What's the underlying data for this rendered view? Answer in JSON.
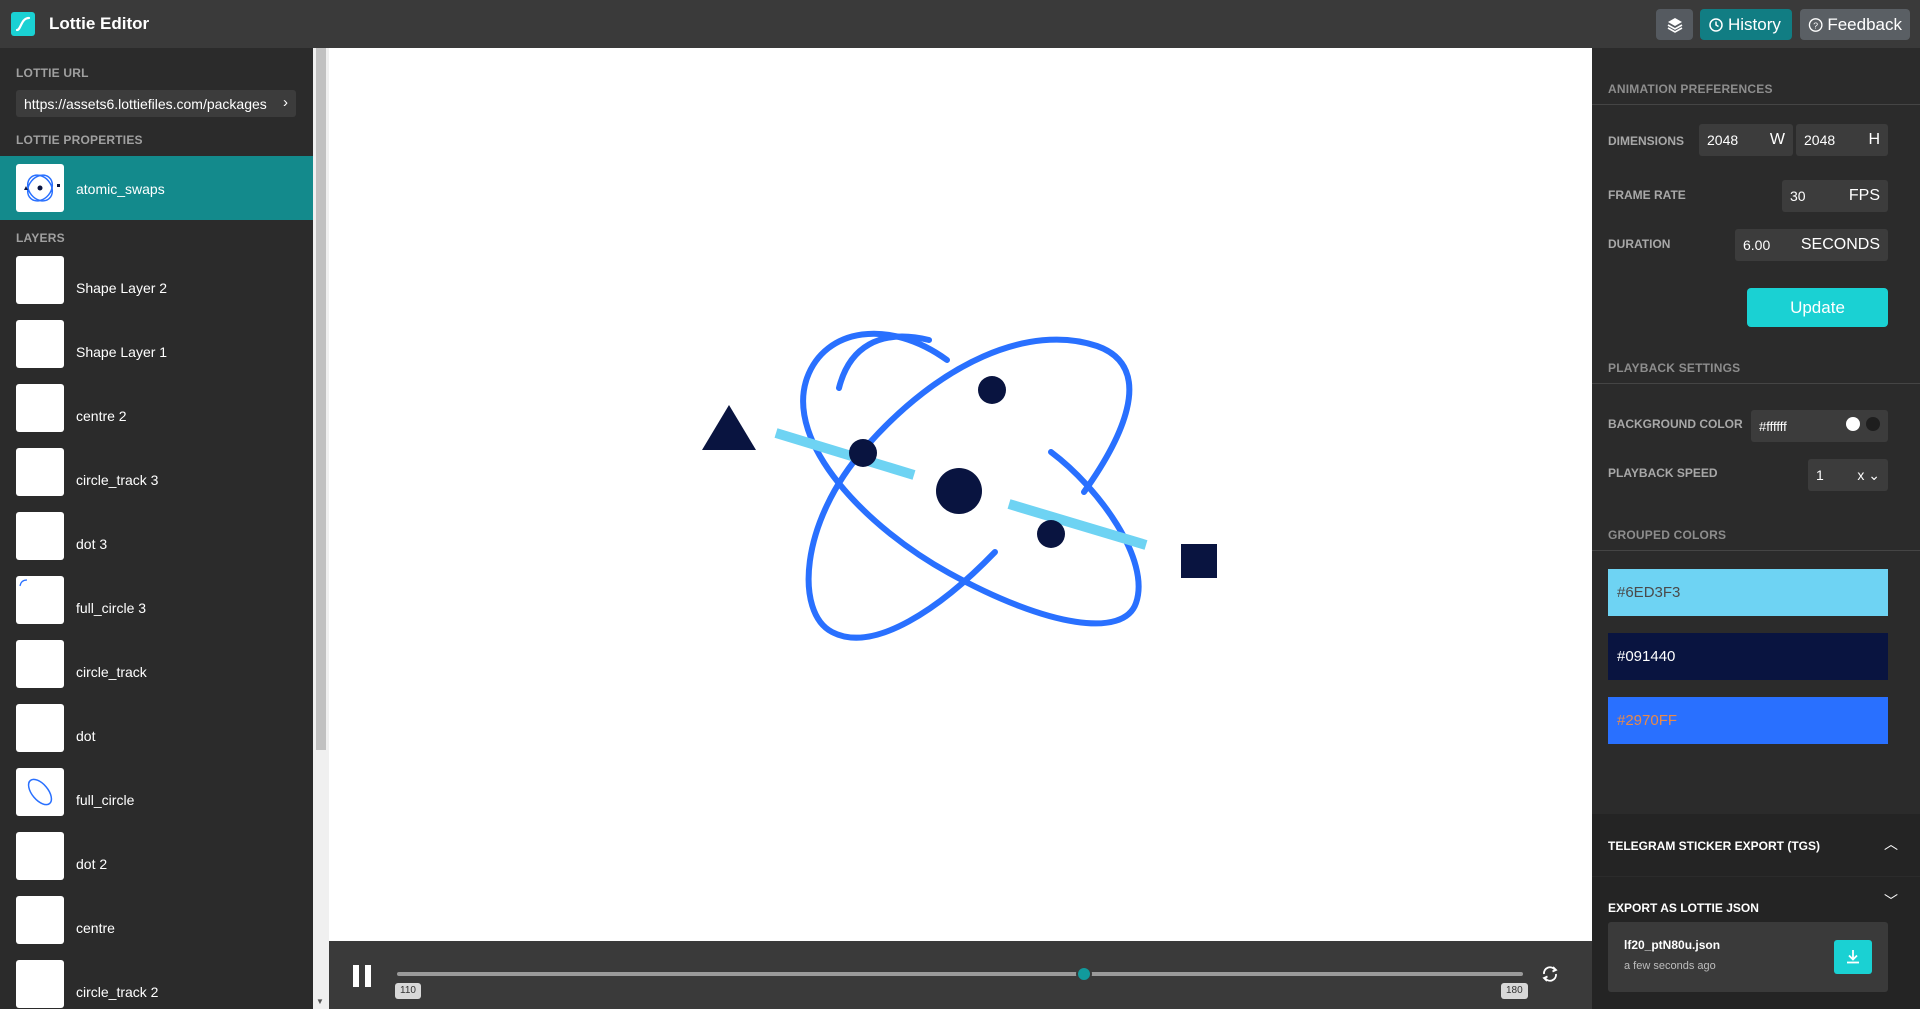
{
  "app": {
    "title": "Lottie Editor"
  },
  "toolbar": {
    "history_label": "History",
    "feedback_label": "Feedback",
    "layers_icon": "layers-icon"
  },
  "sidebar": {
    "url_label": "LOTTIE URL",
    "url_value": "https://assets6.lottiefiles.com/packages",
    "properties_label": "LOTTIE PROPERTIES",
    "animation_name": "atomic_swaps",
    "layers_label": "LAYERS",
    "layers": [
      {
        "name": "Shape Layer 2"
      },
      {
        "name": "Shape Layer 1"
      },
      {
        "name": "centre 2"
      },
      {
        "name": "circle_track 3"
      },
      {
        "name": "dot 3"
      },
      {
        "name": "full_circle 3"
      },
      {
        "name": "circle_track"
      },
      {
        "name": "dot"
      },
      {
        "name": "full_circle"
      },
      {
        "name": "dot 2"
      },
      {
        "name": "centre"
      },
      {
        "name": "circle_track 2"
      }
    ]
  },
  "playback": {
    "start_frame": "110",
    "end_frame": "180",
    "progress": 0.61
  },
  "preferences": {
    "title": "ANIMATION PREFERENCES",
    "dimensions_label": "DIMENSIONS",
    "width": "2048",
    "width_unit": "W",
    "height": "2048",
    "height_unit": "H",
    "frame_rate_label": "FRAME RATE",
    "frame_rate": "30",
    "frame_rate_unit": "FPS",
    "duration_label": "DURATION",
    "duration": "6.00",
    "duration_unit": "SECONDS",
    "update_label": "Update"
  },
  "playback_settings": {
    "title": "PLAYBACK SETTINGS",
    "bg_color_label": "BACKGROUND COLOR",
    "bg_color": "#ffffff",
    "speed_label": "PLAYBACK SPEED",
    "speed": "1",
    "speed_unit": "x"
  },
  "grouped_colors": {
    "title": "GROUPED COLORS",
    "colors": [
      {
        "hex": "#6ED3F3",
        "text_color": "#4a4a4a"
      },
      {
        "hex": "#091440",
        "text_color": "#ffffff"
      },
      {
        "hex": "#2970FF",
        "text_color": "#e8894a"
      }
    ]
  },
  "export": {
    "tgs_title": "TELEGRAM STICKER EXPORT (TGS)",
    "json_title": "EXPORT AS LOTTIE JSON",
    "file_name": "lf20_ptN80u.json",
    "file_time": "a few seconds ago"
  },
  "colors": {
    "accent": "#1ad1d3",
    "selected_row": "#138a8c",
    "dark_navy": "#091440",
    "blue": "#2970FF",
    "light_blue": "#6ED3F3"
  }
}
